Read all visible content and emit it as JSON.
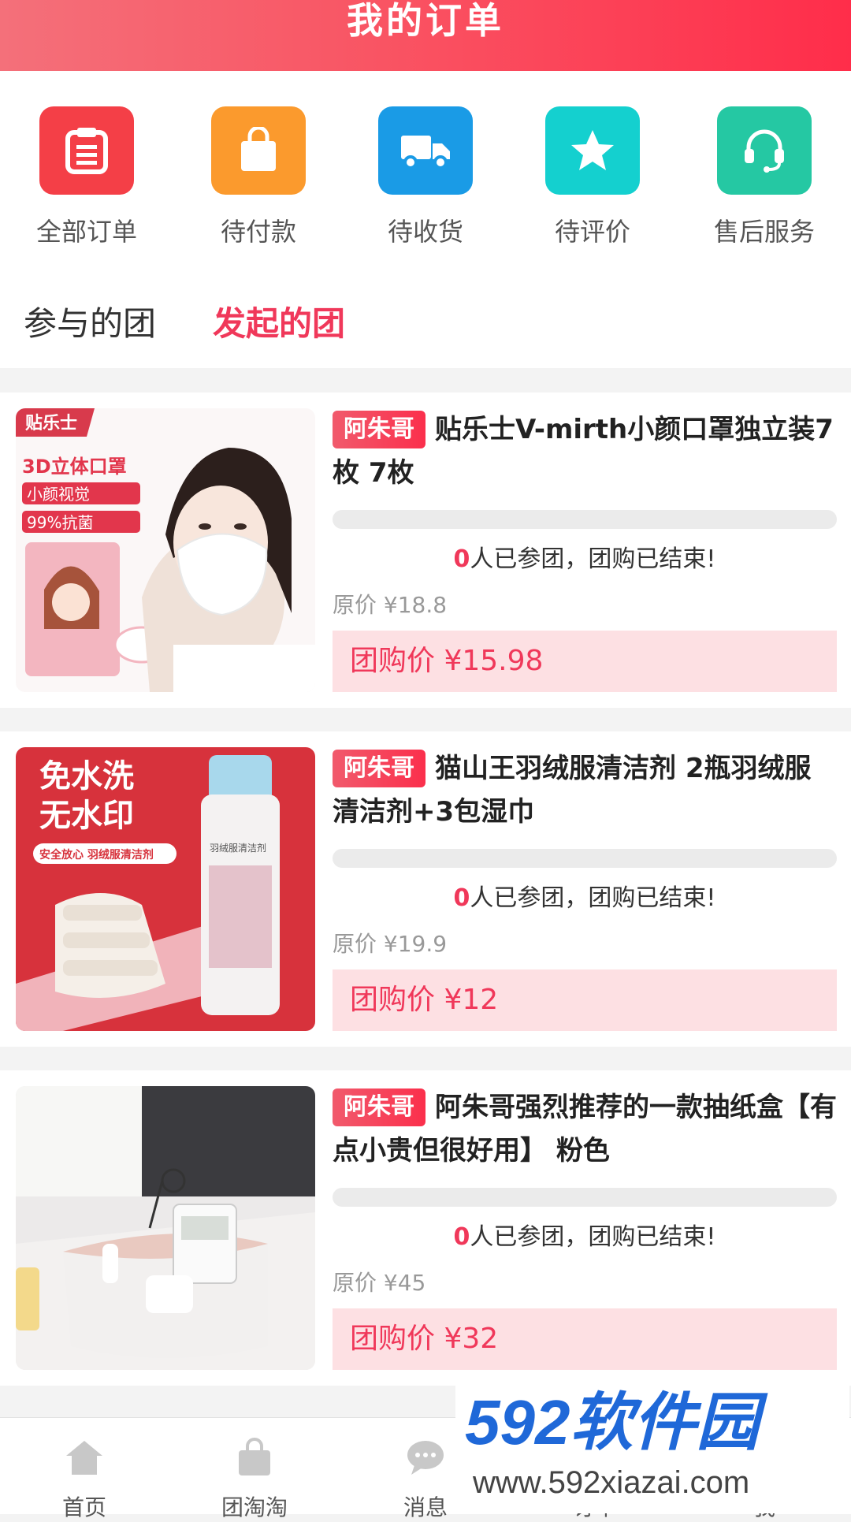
{
  "header": {
    "title": "我的订单"
  },
  "quick_actions": [
    {
      "label": "全部订单",
      "icon": "clipboard-icon",
      "color": "#f43f47"
    },
    {
      "label": "待付款",
      "icon": "shopping-bag-icon",
      "color": "#fb9a2d"
    },
    {
      "label": "待收货",
      "icon": "truck-icon",
      "color": "#1a9be6"
    },
    {
      "label": "待评价",
      "icon": "star-icon",
      "color": "#14d0cf"
    },
    {
      "label": "售后服务",
      "icon": "headset-icon",
      "color": "#25c8a3"
    }
  ],
  "tabs": {
    "joined": "参与的团",
    "started": "发起的团",
    "active": "started"
  },
  "products": [
    {
      "badge": "阿朱哥",
      "title": "贴乐士V-mirth小颜口罩独立装7枚 7枚",
      "progress": 0,
      "joined_count": "0",
      "joined_text": "人已参团，团购已结束!",
      "original_price": "原价 ¥18.8",
      "group_price": "团购价 ¥15.98",
      "image": {
        "brand": "贴乐士",
        "line1": "3D立体口罩",
        "line2": "小颜视觉",
        "line3": "99%抗菌"
      }
    },
    {
      "badge": "阿朱哥",
      "title": "猫山王羽绒服清洁剂 2瓶羽绒服清洁剂+3包湿巾",
      "progress": 0,
      "joined_count": "0",
      "joined_text": "人已参团，团购已结束!",
      "original_price": "原价 ¥19.9",
      "group_price": "团购价 ¥12",
      "image": {
        "line1": "免水洗",
        "line2": "无水印",
        "line3": "安全放心 羽绒服清洁剂",
        "bottle": "羽绒服清洁剂"
      }
    },
    {
      "badge": "阿朱哥",
      "title": "阿朱哥强烈推荐的一款抽纸盒【有点小贵但很好用】 粉色",
      "progress": 0,
      "joined_count": "0",
      "joined_text": "人已参团，团购已结束!",
      "original_price": "原价 ¥45",
      "group_price": "团购价 ¥32",
      "image": {}
    }
  ],
  "bottom_nav": [
    {
      "label": "首页",
      "icon": "home-icon"
    },
    {
      "label": "团淘淘",
      "icon": "bag-icon"
    },
    {
      "label": "消息",
      "icon": "chat-icon"
    },
    {
      "label": "订单",
      "icon": "order-icon"
    },
    {
      "label": "我",
      "icon": "user-icon"
    }
  ],
  "watermark": {
    "brand": "592软件园",
    "url": "www.592xiazai.com"
  }
}
